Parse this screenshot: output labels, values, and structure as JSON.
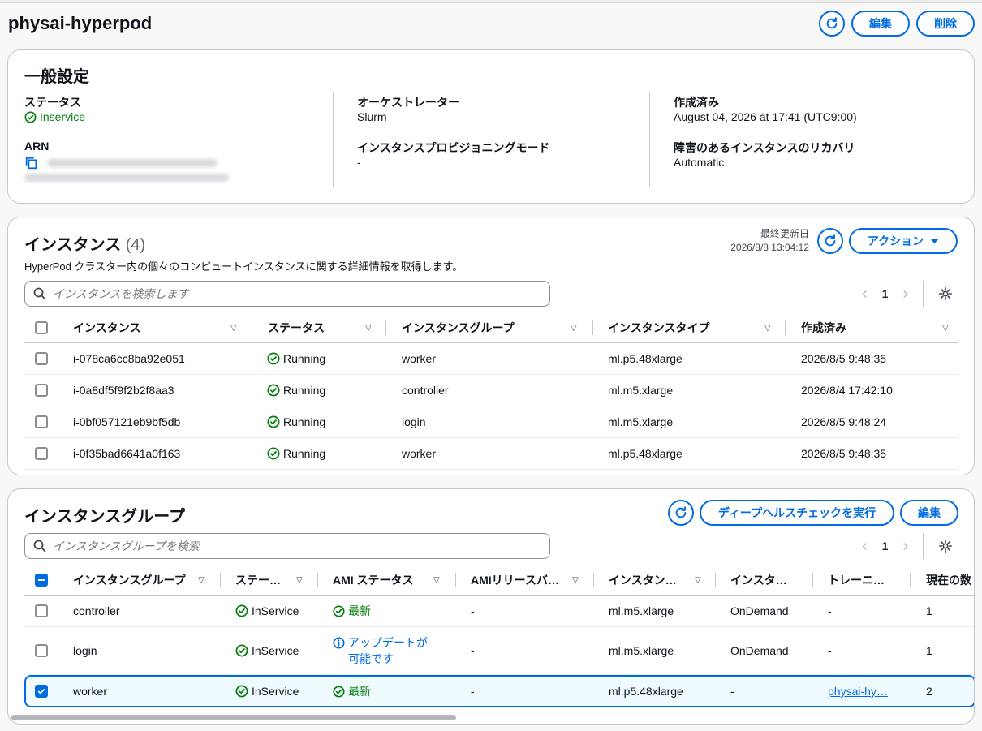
{
  "page": {
    "title": "physai-hyperpod",
    "edit_label": "編集",
    "delete_label": "削除"
  },
  "general": {
    "title": "一般設定",
    "status_label": "ステータス",
    "status_value": "Inservice",
    "arn_label": "ARN",
    "orchestrator_label": "オーケストレーター",
    "orchestrator_value": "Slurm",
    "provisioning_label": "インスタンスプロビジョニングモード",
    "provisioning_value": "-",
    "created_label": "作成済み",
    "created_value": "August 04, 2026 at 17:41 (UTC9:00)",
    "recovery_label": "障害のあるインスタンスのリカバリ",
    "recovery_value": "Automatic"
  },
  "instances": {
    "title": "インスタンス",
    "count": "(4)",
    "last_updated_label": "最終更新日",
    "last_updated_value": "2026/8/8 13:04:12",
    "actions_label": "アクション",
    "description": "HyperPod クラスター内の個々のコンピュートインスタンスに関する詳細情報を取得します。",
    "search_placeholder": "インスタンスを検索します",
    "page": "1",
    "columns": [
      "インスタンス",
      "ステータス",
      "インスタンスグループ",
      "インスタンスタイプ",
      "作成済み"
    ],
    "rows": [
      {
        "id": "i-078ca6cc8ba92e051",
        "status": "Running",
        "group": "worker",
        "type": "ml.p5.48xlarge",
        "created": "2026/8/5 9:48:35"
      },
      {
        "id": "i-0a8df5f9f2b2f8aa3",
        "status": "Running",
        "group": "controller",
        "type": "ml.m5.xlarge",
        "created": "2026/8/4 17:42:10"
      },
      {
        "id": "i-0bf057121eb9bf5db",
        "status": "Running",
        "group": "login",
        "type": "ml.m5.xlarge",
        "created": "2026/8/5 9:48:24"
      },
      {
        "id": "i-0f35bad6641a0f163",
        "status": "Running",
        "group": "worker",
        "type": "ml.p5.48xlarge",
        "created": "2026/8/5 9:48:35"
      }
    ]
  },
  "groups": {
    "title": "インスタンスグループ",
    "deep_health_label": "ディープヘルスチェックを実行",
    "edit_label": "編集",
    "search_placeholder": "インスタンスグループを検索",
    "page": "1",
    "columns": [
      "インスタンスグループ",
      "ステー…",
      "AMI ステータス",
      "AMIリリースバ…",
      "インスタン…",
      "インスタ…",
      "トレーニ…",
      "現在の数"
    ],
    "rows": [
      {
        "name": "controller",
        "status": "InService",
        "ami_status": "最新",
        "ami_release": "-",
        "instance_type": "ml.m5.xlarge",
        "purchase": "OnDemand",
        "training": "-",
        "count": "1"
      },
      {
        "name": "login",
        "status": "InService",
        "ami_status_line1": "アップデートが",
        "ami_status_line2": "可能です",
        "ami_release": "-",
        "instance_type": "ml.m5.xlarge",
        "purchase": "OnDemand",
        "training": "-",
        "count": "1"
      },
      {
        "name": "worker",
        "status": "InService",
        "ami_status": "最新",
        "ami_release": "-",
        "instance_type": "ml.p5.48xlarge",
        "purchase": "-",
        "training": "physai-hy…",
        "count": "2"
      }
    ]
  },
  "colors": {
    "accent": "#006ce0",
    "success": "#037f0c",
    "border": "#c6c6cd"
  },
  "icons": {
    "refresh": "refresh-icon",
    "status_ok": "check-circle-icon",
    "info": "info-circle-icon",
    "copy": "copy-icon",
    "search": "search-icon",
    "settings": "gear-icon",
    "caret": "caret-down-icon"
  }
}
